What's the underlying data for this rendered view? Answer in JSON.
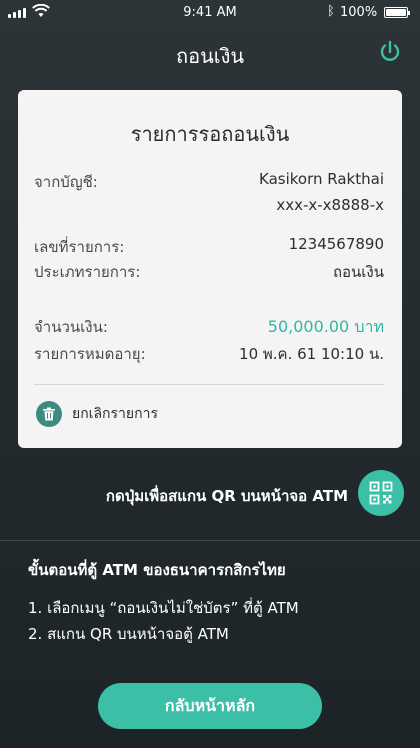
{
  "status_bar": {
    "time": "9:41 AM",
    "battery": "100%",
    "bluetooth_icon": "bluetooth-icon"
  },
  "header": {
    "title": "ถอนเงิน",
    "power_icon": "power-icon"
  },
  "card": {
    "title": "รายการรอถอนเงิน",
    "from_account_label": "จากบัญชี:",
    "account_name": "Kasikorn Rakthai",
    "account_number": "xxx-x-x8888-x",
    "ref_label": "เลขที่รายการ:",
    "ref_value": "1234567890",
    "type_label": "ประเภทรายการ:",
    "type_value": "ถอนเงิน",
    "amount_label": "จำนวนเงิน:",
    "amount_value": "50,000.00 บาท",
    "expire_label": "รายการหมดอายุ:",
    "expire_value": "10 พ.ค. 61  10:10 น.",
    "cancel_label": "ยกเลิกรายการ"
  },
  "qr": {
    "prompt": "กดปุ่มเพื่อสแกน QR บนหน้าจอ ATM"
  },
  "steps": {
    "title": "ขั้นตอนที่ตู้ ATM ของธนาคารกสิกรไทย",
    "items": [
      "1. เลือกเมนู “ถอนเงินไม่ใช่บัตร” ที่ตู้ ATM",
      "2. สแกน QR บนหน้าจอตู้ ATM"
    ]
  },
  "home_button": "กลับหน้าหลัก",
  "colors": {
    "accent": "#3cbfa7",
    "amount": "#2fb8a6",
    "trash_bg": "#3e8a80"
  }
}
